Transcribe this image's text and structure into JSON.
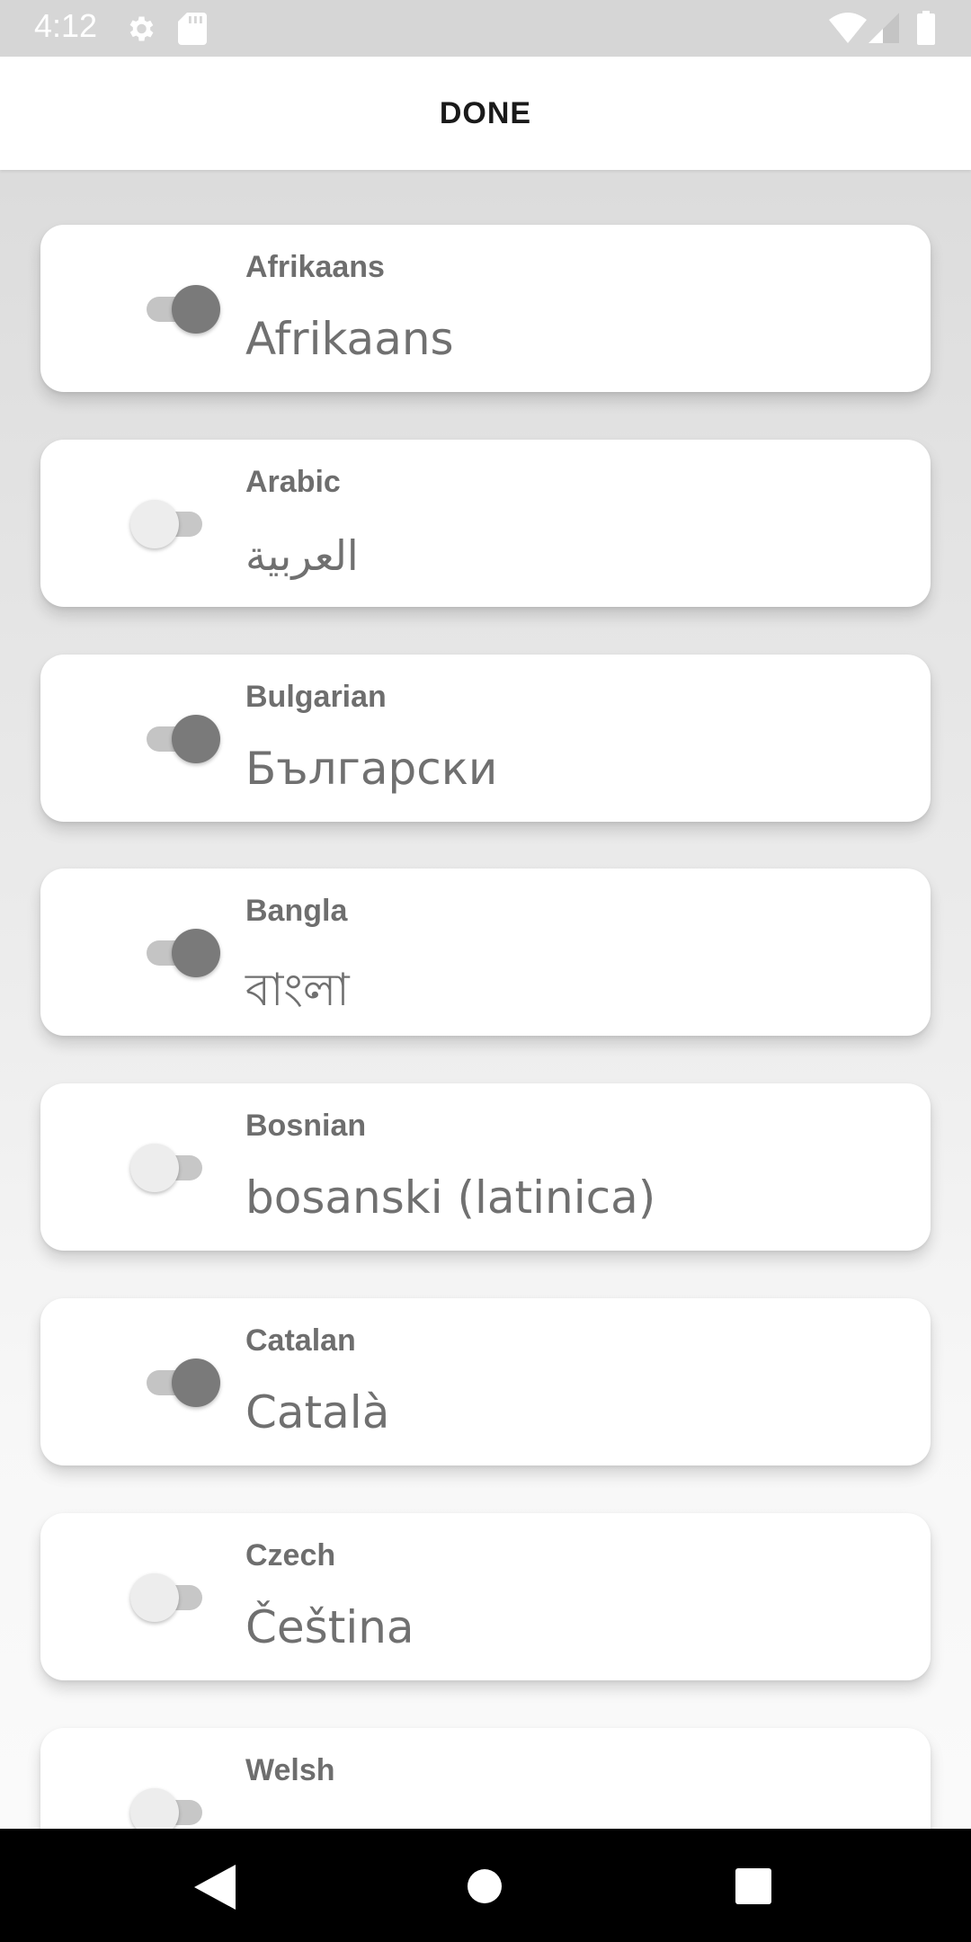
{
  "status_bar": {
    "time": "4:12",
    "icons": [
      "gear-icon",
      "sd-card-icon",
      "wifi-icon",
      "signal-icon",
      "battery-icon"
    ]
  },
  "header": {
    "done_label": "DONE"
  },
  "languages": [
    {
      "name": "Afrikaans",
      "native": "Afrikaans",
      "enabled": true
    },
    {
      "name": "Arabic",
      "native": "العربية",
      "enabled": false
    },
    {
      "name": "Bulgarian",
      "native": "Български",
      "enabled": true
    },
    {
      "name": "Bangla",
      "native": "বাংলা",
      "enabled": true
    },
    {
      "name": "Bosnian",
      "native": "bosanski (latinica)",
      "enabled": false
    },
    {
      "name": "Catalan",
      "native": "Català",
      "enabled": true
    },
    {
      "name": "Czech",
      "native": "Čeština",
      "enabled": false
    },
    {
      "name": "Welsh",
      "native": "",
      "enabled": false
    }
  ],
  "nav_bar": {
    "icons": [
      "back-icon",
      "home-icon",
      "recents-icon"
    ]
  },
  "colors": {
    "toggle_on_knob": "#7a7a7a",
    "toggle_off_knob": "#ededed",
    "toggle_track": "#c7c7c7",
    "card": "#ffffff",
    "status_bar": "#d6d6d6",
    "nav_bar": "#000000"
  }
}
